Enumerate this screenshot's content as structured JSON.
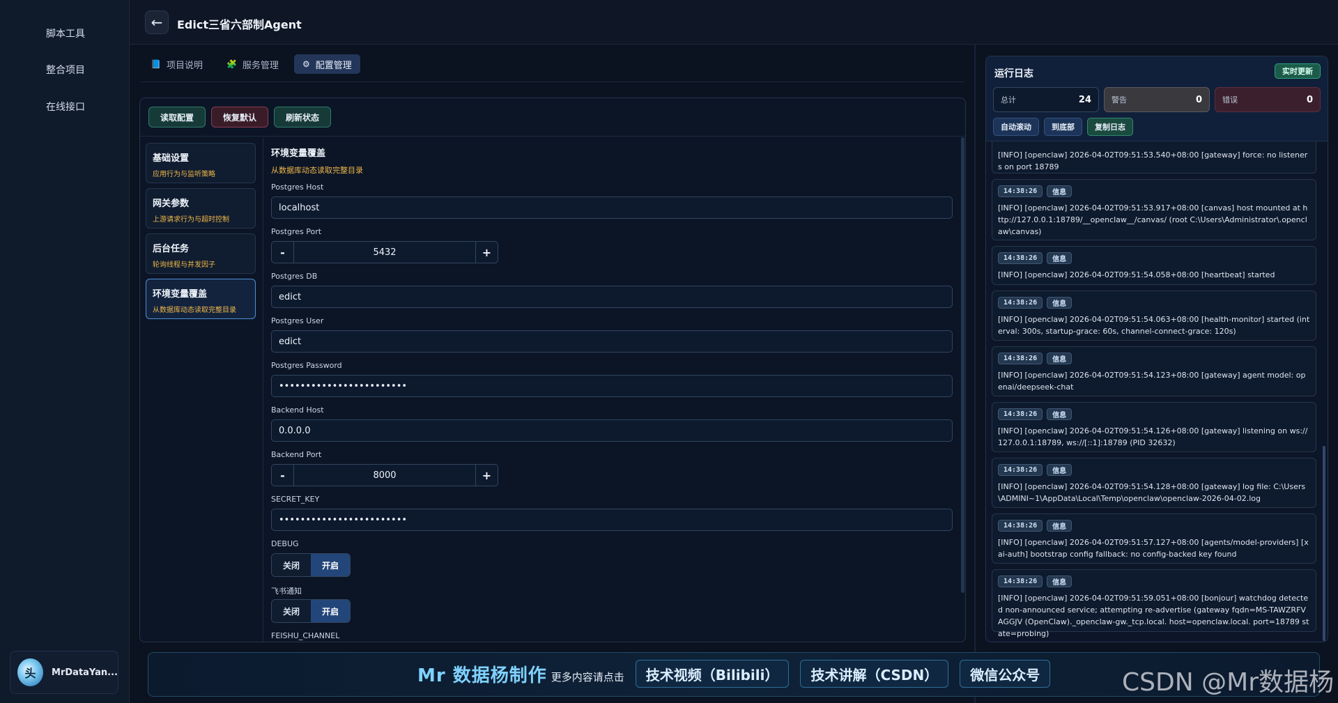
{
  "sidebar": {
    "items": [
      "脚本工具",
      "整合项目",
      "在线接口"
    ],
    "user": {
      "name": "MrDataYan...",
      "avatar_text": "头"
    }
  },
  "header": {
    "back_icon": "←",
    "title": "Edict三省六部制Agent"
  },
  "tabs": [
    {
      "label": "项目说明",
      "icon": "📘"
    },
    {
      "label": "服务管理",
      "icon": "🧩"
    },
    {
      "label": "配置管理",
      "icon": "⚙"
    }
  ],
  "toolbar": {
    "read": "读取配置",
    "reset": "恢复默认",
    "refresh": "刷新状态"
  },
  "categories": [
    {
      "title": "基础设置",
      "desc": "应用行为与监听策略"
    },
    {
      "title": "网关参数",
      "desc": "上游请求行为与超时控制"
    },
    {
      "title": "后台任务",
      "desc": "轮询线程与并发因子"
    },
    {
      "title": "环境变量覆盖",
      "desc": "从数据库动态读取完整目录"
    }
  ],
  "form": {
    "title": "环境变量覆盖",
    "subtitle": "从数据库动态读取完整目录",
    "pg_host_label": "Postgres Host",
    "pg_host": "localhost",
    "pg_port_label": "Postgres Port",
    "pg_port": "5432",
    "pg_db_label": "Postgres DB",
    "pg_db": "edict",
    "pg_user_label": "Postgres User",
    "pg_user": "edict",
    "pg_pass_label": "Postgres Password",
    "pg_pass": "••••••••••••••••••••••••",
    "be_host_label": "Backend Host",
    "be_host": "0.0.0.0",
    "be_port_label": "Backend Port",
    "be_port": "8000",
    "secret_label": "SECRET_KEY",
    "secret": "••••••••••••••••••••••••",
    "debug_label": "DEBUG",
    "feishu_label": "飞书通知",
    "off": "关闭",
    "on": "开启",
    "feishu_channel_label": "FEISHU_CHANNEL"
  },
  "log": {
    "title": "运行日志",
    "live": "实时更新",
    "total_label": "总计",
    "total": "24",
    "warn_label": "警告",
    "warn": "0",
    "err_label": "错误",
    "err": "0",
    "auto_scroll": "自动滚动",
    "to_bottom": "到底部",
    "copy": "复制日志",
    "entries": [
      {
        "time": "",
        "level": "",
        "msg": "[INFO] [openclaw] 2026-04-02T09:51:53.540+08:00 [gateway] force: no listeners on port 18789"
      },
      {
        "time": "14:38:26",
        "level": "信息",
        "msg": "[INFO] [openclaw] 2026-04-02T09:51:53.917+08:00 [canvas] host mounted at http://127.0.0.1:18789/__openclaw__/canvas/ (root C:\\Users\\Administrator\\.openclaw\\canvas)"
      },
      {
        "time": "14:38:26",
        "level": "信息",
        "msg": "[INFO] [openclaw] 2026-04-02T09:51:54.058+08:00 [heartbeat] started"
      },
      {
        "time": "14:38:26",
        "level": "信息",
        "msg": "[INFO] [openclaw] 2026-04-02T09:51:54.063+08:00 [health-monitor] started (interval: 300s, startup-grace: 60s, channel-connect-grace: 120s)"
      },
      {
        "time": "14:38:26",
        "level": "信息",
        "msg": "[INFO] [openclaw] 2026-04-02T09:51:54.123+08:00 [gateway] agent model: openai/deepseek-chat"
      },
      {
        "time": "14:38:26",
        "level": "信息",
        "msg": "[INFO] [openclaw] 2026-04-02T09:51:54.126+08:00 [gateway] listening on ws://127.0.0.1:18789, ws://[::1]:18789 (PID 32632)"
      },
      {
        "time": "14:38:26",
        "level": "信息",
        "msg": "[INFO] [openclaw] 2026-04-02T09:51:54.128+08:00 [gateway] log file: C:\\Users\\ADMINI~1\\AppData\\Local\\Temp\\openclaw\\openclaw-2026-04-02.log"
      },
      {
        "time": "14:38:26",
        "level": "信息",
        "msg": "[INFO] [openclaw] 2026-04-02T09:51:57.127+08:00 [agents/model-providers] [xai-auth] bootstrap config fallback: no config-backed key found"
      },
      {
        "time": "14:38:26",
        "level": "信息",
        "msg": "[INFO] [openclaw] 2026-04-02T09:51:59.051+08:00 [bonjour] watchdog detected non-announced service; attempting re-advertise (gateway fqdn=MS-TAWZRFVAGGJV (OpenClaw)._openclaw-gw._tcp.local. host=openclaw.local. port=18789 state=probing)"
      }
    ]
  },
  "promo": {
    "brand": "Mr 数据杨制作",
    "sub": "更多内容请点击",
    "links": [
      "技术视频（Bilibili）",
      "技术讲解（CSDN）",
      "微信公众号"
    ]
  },
  "watermark": "CSDN @Mr数据杨"
}
